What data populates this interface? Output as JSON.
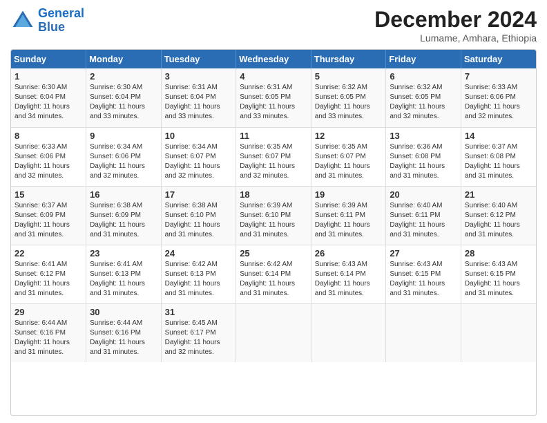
{
  "logo": {
    "line1": "General",
    "line2": "Blue"
  },
  "title": "December 2024",
  "location": "Lumame, Amhara, Ethiopia",
  "days_header": [
    "Sunday",
    "Monday",
    "Tuesday",
    "Wednesday",
    "Thursday",
    "Friday",
    "Saturday"
  ],
  "weeks": [
    [
      {
        "day": "1",
        "lines": [
          "Sunrise: 6:30 AM",
          "Sunset: 6:04 PM",
          "Daylight: 11 hours",
          "and 34 minutes."
        ]
      },
      {
        "day": "2",
        "lines": [
          "Sunrise: 6:30 AM",
          "Sunset: 6:04 PM",
          "Daylight: 11 hours",
          "and 33 minutes."
        ]
      },
      {
        "day": "3",
        "lines": [
          "Sunrise: 6:31 AM",
          "Sunset: 6:04 PM",
          "Daylight: 11 hours",
          "and 33 minutes."
        ]
      },
      {
        "day": "4",
        "lines": [
          "Sunrise: 6:31 AM",
          "Sunset: 6:05 PM",
          "Daylight: 11 hours",
          "and 33 minutes."
        ]
      },
      {
        "day": "5",
        "lines": [
          "Sunrise: 6:32 AM",
          "Sunset: 6:05 PM",
          "Daylight: 11 hours",
          "and 33 minutes."
        ]
      },
      {
        "day": "6",
        "lines": [
          "Sunrise: 6:32 AM",
          "Sunset: 6:05 PM",
          "Daylight: 11 hours",
          "and 32 minutes."
        ]
      },
      {
        "day": "7",
        "lines": [
          "Sunrise: 6:33 AM",
          "Sunset: 6:06 PM",
          "Daylight: 11 hours",
          "and 32 minutes."
        ]
      }
    ],
    [
      {
        "day": "8",
        "lines": [
          "Sunrise: 6:33 AM",
          "Sunset: 6:06 PM",
          "Daylight: 11 hours",
          "and 32 minutes."
        ]
      },
      {
        "day": "9",
        "lines": [
          "Sunrise: 6:34 AM",
          "Sunset: 6:06 PM",
          "Daylight: 11 hours",
          "and 32 minutes."
        ]
      },
      {
        "day": "10",
        "lines": [
          "Sunrise: 6:34 AM",
          "Sunset: 6:07 PM",
          "Daylight: 11 hours",
          "and 32 minutes."
        ]
      },
      {
        "day": "11",
        "lines": [
          "Sunrise: 6:35 AM",
          "Sunset: 6:07 PM",
          "Daylight: 11 hours",
          "and 32 minutes."
        ]
      },
      {
        "day": "12",
        "lines": [
          "Sunrise: 6:35 AM",
          "Sunset: 6:07 PM",
          "Daylight: 11 hours",
          "and 31 minutes."
        ]
      },
      {
        "day": "13",
        "lines": [
          "Sunrise: 6:36 AM",
          "Sunset: 6:08 PM",
          "Daylight: 11 hours",
          "and 31 minutes."
        ]
      },
      {
        "day": "14",
        "lines": [
          "Sunrise: 6:37 AM",
          "Sunset: 6:08 PM",
          "Daylight: 11 hours",
          "and 31 minutes."
        ]
      }
    ],
    [
      {
        "day": "15",
        "lines": [
          "Sunrise: 6:37 AM",
          "Sunset: 6:09 PM",
          "Daylight: 11 hours",
          "and 31 minutes."
        ]
      },
      {
        "day": "16",
        "lines": [
          "Sunrise: 6:38 AM",
          "Sunset: 6:09 PM",
          "Daylight: 11 hours",
          "and 31 minutes."
        ]
      },
      {
        "day": "17",
        "lines": [
          "Sunrise: 6:38 AM",
          "Sunset: 6:10 PM",
          "Daylight: 11 hours",
          "and 31 minutes."
        ]
      },
      {
        "day": "18",
        "lines": [
          "Sunrise: 6:39 AM",
          "Sunset: 6:10 PM",
          "Daylight: 11 hours",
          "and 31 minutes."
        ]
      },
      {
        "day": "19",
        "lines": [
          "Sunrise: 6:39 AM",
          "Sunset: 6:11 PM",
          "Daylight: 11 hours",
          "and 31 minutes."
        ]
      },
      {
        "day": "20",
        "lines": [
          "Sunrise: 6:40 AM",
          "Sunset: 6:11 PM",
          "Daylight: 11 hours",
          "and 31 minutes."
        ]
      },
      {
        "day": "21",
        "lines": [
          "Sunrise: 6:40 AM",
          "Sunset: 6:12 PM",
          "Daylight: 11 hours",
          "and 31 minutes."
        ]
      }
    ],
    [
      {
        "day": "22",
        "lines": [
          "Sunrise: 6:41 AM",
          "Sunset: 6:12 PM",
          "Daylight: 11 hours",
          "and 31 minutes."
        ]
      },
      {
        "day": "23",
        "lines": [
          "Sunrise: 6:41 AM",
          "Sunset: 6:13 PM",
          "Daylight: 11 hours",
          "and 31 minutes."
        ]
      },
      {
        "day": "24",
        "lines": [
          "Sunrise: 6:42 AM",
          "Sunset: 6:13 PM",
          "Daylight: 11 hours",
          "and 31 minutes."
        ]
      },
      {
        "day": "25",
        "lines": [
          "Sunrise: 6:42 AM",
          "Sunset: 6:14 PM",
          "Daylight: 11 hours",
          "and 31 minutes."
        ]
      },
      {
        "day": "26",
        "lines": [
          "Sunrise: 6:43 AM",
          "Sunset: 6:14 PM",
          "Daylight: 11 hours",
          "and 31 minutes."
        ]
      },
      {
        "day": "27",
        "lines": [
          "Sunrise: 6:43 AM",
          "Sunset: 6:15 PM",
          "Daylight: 11 hours",
          "and 31 minutes."
        ]
      },
      {
        "day": "28",
        "lines": [
          "Sunrise: 6:43 AM",
          "Sunset: 6:15 PM",
          "Daylight: 11 hours",
          "and 31 minutes."
        ]
      }
    ],
    [
      {
        "day": "29",
        "lines": [
          "Sunrise: 6:44 AM",
          "Sunset: 6:16 PM",
          "Daylight: 11 hours",
          "and 31 minutes."
        ]
      },
      {
        "day": "30",
        "lines": [
          "Sunrise: 6:44 AM",
          "Sunset: 6:16 PM",
          "Daylight: 11 hours",
          "and 31 minutes."
        ]
      },
      {
        "day": "31",
        "lines": [
          "Sunrise: 6:45 AM",
          "Sunset: 6:17 PM",
          "Daylight: 11 hours",
          "and 32 minutes."
        ]
      },
      {
        "day": "",
        "lines": []
      },
      {
        "day": "",
        "lines": []
      },
      {
        "day": "",
        "lines": []
      },
      {
        "day": "",
        "lines": []
      }
    ]
  ]
}
